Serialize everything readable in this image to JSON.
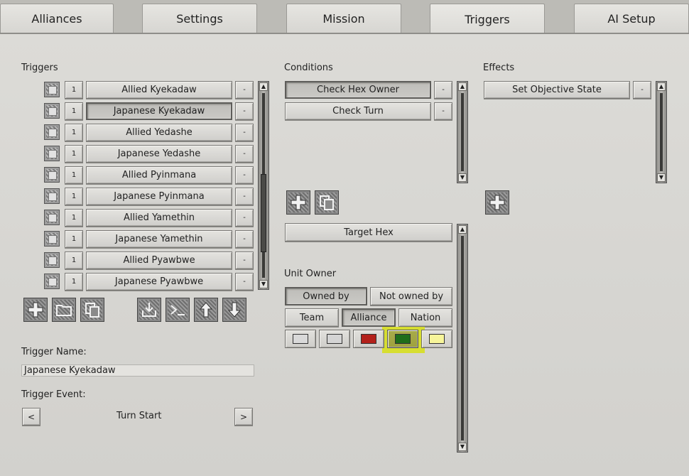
{
  "tabs": [
    {
      "label": "Alliances"
    },
    {
      "label": "Settings"
    },
    {
      "label": "Mission"
    },
    {
      "label": "Triggers"
    },
    {
      "label": "AI Setup"
    }
  ],
  "triggers": {
    "section_label": "Triggers",
    "rows": [
      {
        "count": "1",
        "name": "Allied Kyekadaw",
        "remove": "-"
      },
      {
        "count": "1",
        "name": "Japanese Kyekadaw",
        "remove": "-"
      },
      {
        "count": "1",
        "name": "Allied Yedashe",
        "remove": "-"
      },
      {
        "count": "1",
        "name": "Japanese Yedashe",
        "remove": "-"
      },
      {
        "count": "1",
        "name": "Allied Pyinmana",
        "remove": "-"
      },
      {
        "count": "1",
        "name": "Japanese Pyinmana",
        "remove": "-"
      },
      {
        "count": "1",
        "name": "Allied Yamethin",
        "remove": "-"
      },
      {
        "count": "1",
        "name": "Japanese Yamethin",
        "remove": "-"
      },
      {
        "count": "1",
        "name": "Allied Pyawbwe",
        "remove": "-"
      },
      {
        "count": "1",
        "name": "Japanese Pyawbwe",
        "remove": "-"
      }
    ],
    "selected_index": 1,
    "toolbar_icons": [
      "plus-icon",
      "folder-icon",
      "copy-icon",
      "import-icon",
      "console-icon",
      "arrow-up-icon",
      "arrow-down-icon"
    ]
  },
  "trigger_name": {
    "label": "Trigger Name:",
    "value": "Japanese Kyekadaw"
  },
  "trigger_event": {
    "label": "Trigger Event:",
    "value": "Turn Start",
    "prev": "<",
    "next": ">"
  },
  "conditions": {
    "section_label": "Conditions",
    "rows": [
      {
        "name": "Check Hex Owner",
        "remove": "-"
      },
      {
        "name": "Check Turn",
        "remove": "-"
      }
    ],
    "selected_index": 0,
    "toolbar_icons": [
      "plus-icon",
      "copy-icon"
    ]
  },
  "condition_detail": {
    "target_hex": "Target Hex",
    "unit_owner_label": "Unit Owner",
    "owned_by": "Owned by",
    "not_owned_by": "Not owned by",
    "team": "Team",
    "alliance": "Alliance",
    "nation": "Nation",
    "swatches": [
      {
        "color": "#d9d9d9"
      },
      {
        "color": "#d4d4d4"
      },
      {
        "color": "#b3211b"
      },
      {
        "color": "#1f6e1a"
      },
      {
        "color": "#f7f59a"
      }
    ],
    "selected_swatch": 3
  },
  "effects": {
    "section_label": "Effects",
    "rows": [
      {
        "name": "Set Objective State",
        "remove": "-"
      }
    ],
    "toolbar_icons": [
      "plus-icon"
    ]
  },
  "colors": {
    "highlight": "#d7df1f"
  }
}
